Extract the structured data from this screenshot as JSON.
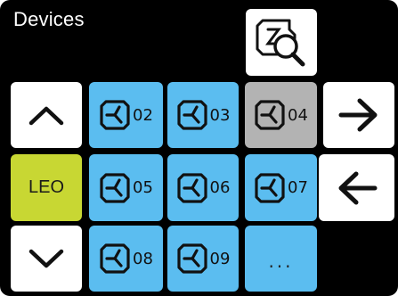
{
  "header": {
    "title": "Devices"
  },
  "search_button": {
    "icon": "device-search-icon"
  },
  "navigation": {
    "scroll_up_icon": "chevron-up-icon",
    "scroll_down_icon": "chevron-down-icon",
    "next_icon": "arrow-right-icon",
    "previous_icon": "arrow-left-icon"
  },
  "group_button": {
    "label": "LEO"
  },
  "devices": [
    {
      "label": "02",
      "selected": false
    },
    {
      "label": "03",
      "selected": false
    },
    {
      "label": "04",
      "selected": true
    },
    {
      "label": "05",
      "selected": false
    },
    {
      "label": "06",
      "selected": false
    },
    {
      "label": "07",
      "selected": false
    },
    {
      "label": "08",
      "selected": false
    },
    {
      "label": "09",
      "selected": false
    }
  ],
  "more_button": {
    "label": "..."
  },
  "colors": {
    "background": "#000000",
    "tile": "#5bbdf0",
    "tile_selected": "#b3b3b3",
    "group": "#c8d733",
    "button": "#ffffff"
  }
}
